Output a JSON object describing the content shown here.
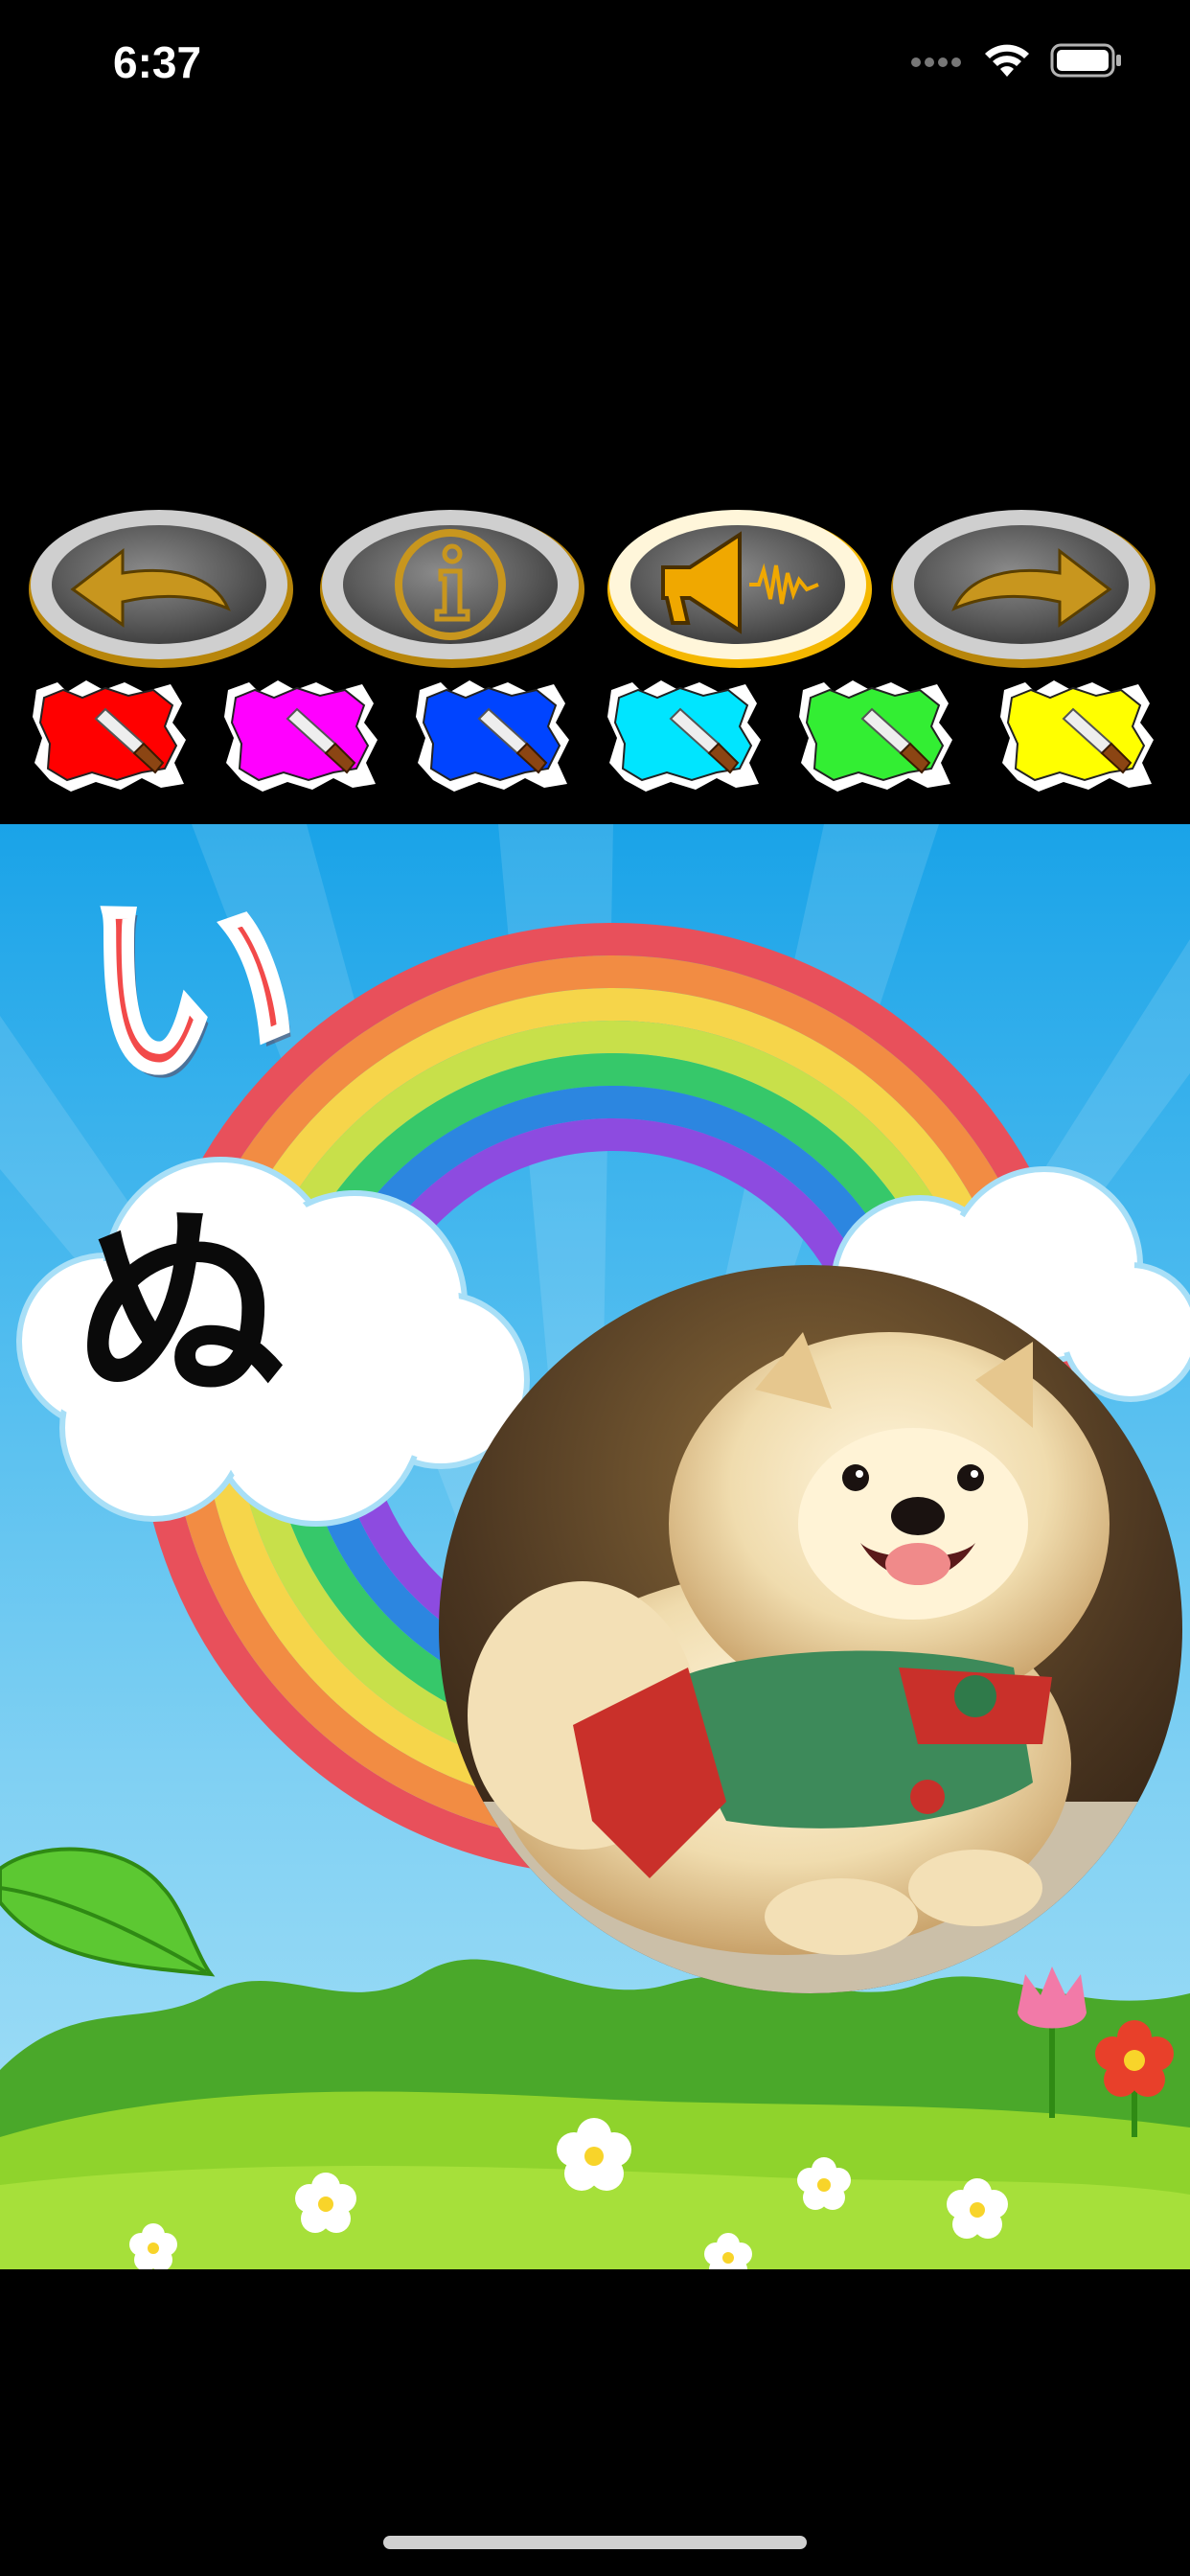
{
  "status_bar": {
    "time": "6:37"
  },
  "toolbar": {
    "buttons": [
      {
        "name": "back-button",
        "icon": "arrow-left-icon"
      },
      {
        "name": "info-button",
        "icon": "info-icon"
      },
      {
        "name": "sound-button",
        "icon": "megaphone-icon",
        "active": true
      },
      {
        "name": "forward-button",
        "icon": "arrow-right-icon"
      }
    ],
    "paint_colors": [
      "#ff0000",
      "#ff00ff",
      "#0044ff",
      "#00e5ff",
      "#33ee33",
      "#ffff00"
    ]
  },
  "card": {
    "kana_top": "い",
    "kana_bottom": "ぬ",
    "picture": "pomeranian-dog-photo"
  }
}
